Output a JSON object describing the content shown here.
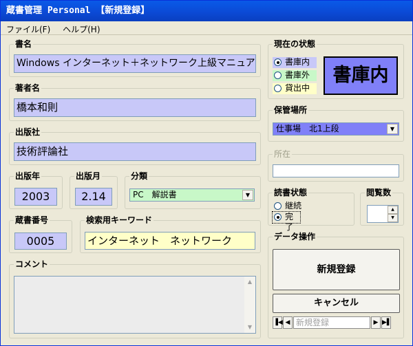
{
  "window": {
    "title": "蔵書管理 Personal 【新規登録】"
  },
  "menu": {
    "file": "ファイル(F)",
    "help": "ヘルプ(H)"
  },
  "book_title": {
    "label": "書名",
    "value": "Windows インターネット＋ネットワーク上級マニュアル"
  },
  "author": {
    "label": "著者名",
    "value": "橋本和則"
  },
  "publisher": {
    "label": "出版社",
    "value": "技術評論社"
  },
  "pub_year": {
    "label": "出版年",
    "value": "2003"
  },
  "pub_month": {
    "label": "出版月",
    "value": "2.14"
  },
  "category": {
    "label": "分類",
    "value": "PC　解説書"
  },
  "book_number": {
    "label": "蔵書番号",
    "value": "0005"
  },
  "keyword": {
    "label": "検索用キーワード",
    "value": "インターネット　ネットワーク"
  },
  "comment": {
    "label": "コメント",
    "value": ""
  },
  "status": {
    "label": "現在の状態",
    "options": [
      "書庫内",
      "書庫外",
      "貸出中"
    ],
    "selected": "書庫内",
    "display": "書庫内"
  },
  "storage": {
    "label": "保管場所",
    "value": "仕事場　北1上段"
  },
  "location": {
    "label": "所在",
    "value": ""
  },
  "reading": {
    "label": "読書状態",
    "options": [
      "継続",
      "完了"
    ],
    "selected": "完了"
  },
  "views": {
    "label": "閲覧数",
    "value": ""
  },
  "data_ops": {
    "label": "データ操作",
    "register_button": "新規登録",
    "cancel_button": "キャンセル",
    "nav_record": "新規登録"
  },
  "colors": {
    "title_bar": "#0b4ad6",
    "field_blue": "#c8c8f8",
    "field_yellow": "#ffffc8",
    "field_green": "#c8f8c8",
    "status_box": "#8080f8"
  }
}
